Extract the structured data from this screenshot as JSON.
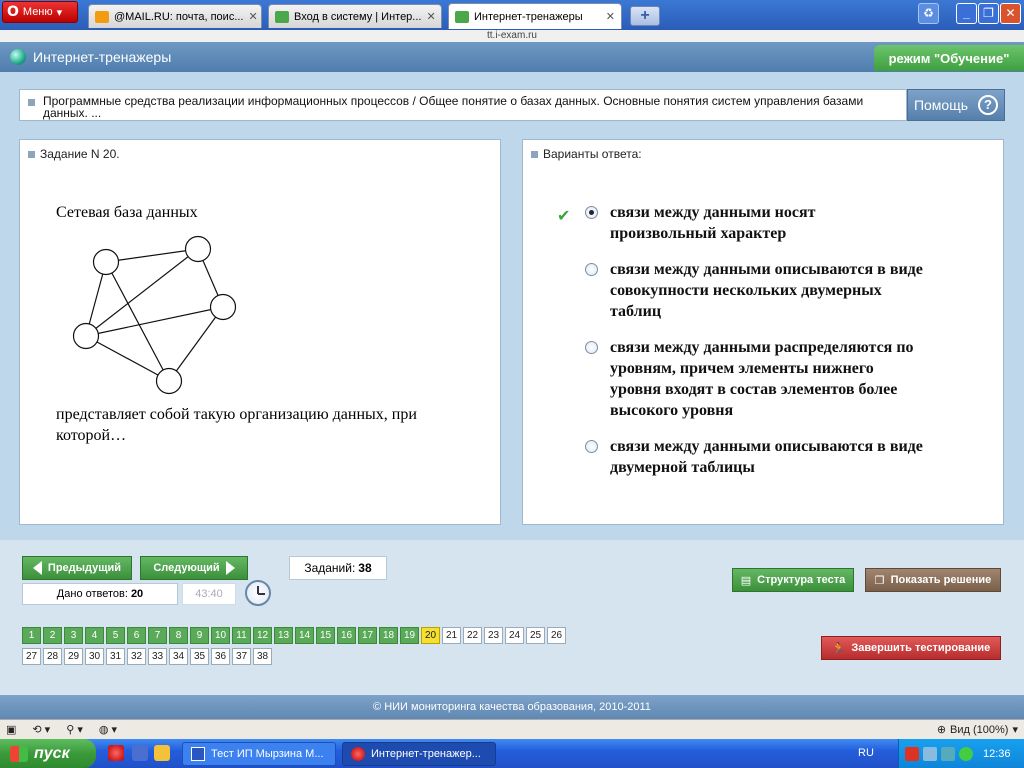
{
  "browser": {
    "menu_label": "Меню",
    "tabs": [
      {
        "label": "@MAIL.RU: почта, поис...",
        "close": "✕"
      },
      {
        "label": "Вход в систему | Интер...",
        "close": "✕"
      },
      {
        "label": "Интернет-тренажеры",
        "close": "✕"
      }
    ],
    "new_tab": "+",
    "url": "tt.i-exam.ru",
    "window_buttons": {
      "minimize": "_",
      "restore": "❐",
      "close": "✕"
    }
  },
  "header": {
    "title": "Интернет-тренажеры",
    "mode": "режим \"Обучение\""
  },
  "topic": {
    "text": "Программные средства реализации информационных процессов / Общее понятие о базах данных. Основные понятия систем управления базами данных. ...",
    "help_label": "Помощь",
    "help_icon": "?"
  },
  "task": {
    "header": "Задание N 20.",
    "heading": "Сетевая база данных",
    "rest": "представляет собой такую организацию данных, при которой…"
  },
  "answers": {
    "header": "Варианты ответа:",
    "selected_index": 0,
    "options": [
      "связи между данными носят произвольный характер",
      "связи между данными описываются в виде совокупности нескольких двумерных таблиц",
      "связи между данными распределяются по уровням, причем элементы нижнего уровня входят в состав элементов более высокого уровня",
      "связи между данными описываются в виде двумерной таблицы"
    ]
  },
  "nav": {
    "prev": "Предыдущий",
    "next": "Следующий",
    "tasks_label": "Заданий:",
    "tasks_count": "38",
    "answered_label": "Дано ответов:",
    "answered_count": "20",
    "timer": "43:40",
    "structure": "Структура теста",
    "show_solution": "Показать решение",
    "finish": "Завершить тестирование",
    "current": 20,
    "answered_through": 19,
    "row1": [
      "1",
      "2",
      "3",
      "4",
      "5",
      "6",
      "7",
      "8",
      "9",
      "10",
      "11",
      "12",
      "13",
      "14",
      "15",
      "16",
      "17",
      "18",
      "19",
      "20",
      "21",
      "22",
      "23",
      "24",
      "25",
      "26"
    ],
    "row2": [
      "27",
      "28",
      "29",
      "30",
      "31",
      "32",
      "33",
      "34",
      "35",
      "36",
      "37",
      "38"
    ]
  },
  "footer": {
    "text": "© НИИ мониторинга качества образования, 2010-2011"
  },
  "statusbar": {
    "zoom": "Вид (100%)"
  },
  "taskbar": {
    "start": "пуск",
    "tasks": [
      "Тест ИП Мырзина М...",
      "Интернет-тренажер..."
    ],
    "lang": "RU",
    "time": "12:36"
  },
  "colors": {
    "accent_green": "#3c903c",
    "brown_button": "#8a7058",
    "red_button": "#c83232",
    "current_cell": "#f5e030"
  }
}
